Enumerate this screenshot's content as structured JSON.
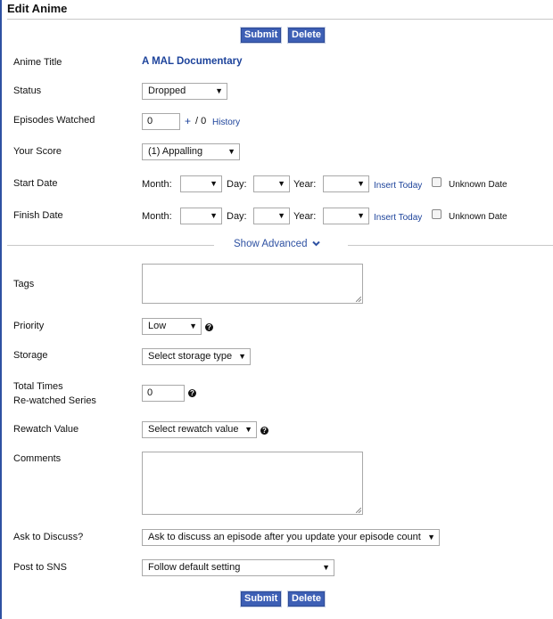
{
  "header": {
    "title": "Edit Anime"
  },
  "buttons": {
    "submit": "Submit",
    "delete": "Delete"
  },
  "form": {
    "anime_title": {
      "label": "Anime Title",
      "value": "A MAL Documentary"
    },
    "status": {
      "label": "Status",
      "value": "Dropped"
    },
    "episodes": {
      "label": "Episodes Watched",
      "value": "0",
      "plus": "+",
      "total": "/ 0",
      "history": "History"
    },
    "score": {
      "label": "Your Score",
      "value": "(1) Appalling"
    },
    "start_date": {
      "label": "Start Date",
      "month": "Month:",
      "day": "Day:",
      "year": "Year:",
      "insert_today": "Insert Today",
      "unknown": "Unknown Date"
    },
    "finish_date": {
      "label": "Finish Date",
      "month": "Month:",
      "day": "Day:",
      "year": "Year:",
      "insert_today": "Insert Today",
      "unknown": "Unknown Date"
    },
    "show_advanced": "Show Advanced",
    "tags": {
      "label": "Tags",
      "value": ""
    },
    "priority": {
      "label": "Priority",
      "value": "Low"
    },
    "storage": {
      "label": "Storage",
      "value": "Select storage type"
    },
    "rewatched": {
      "label_line1": "Total Times",
      "label_line2": "Re-watched Series",
      "value": "0"
    },
    "rewatch_value": {
      "label": "Rewatch Value",
      "value": "Select rewatch value"
    },
    "comments": {
      "label": "Comments",
      "value": ""
    },
    "ask_discuss": {
      "label": "Ask to Discuss?",
      "value": "Ask to discuss an episode after you update your episode count"
    },
    "post_sns": {
      "label": "Post to SNS",
      "value": "Follow default setting"
    }
  },
  "icons": {
    "dropdown": "caret-down-icon",
    "help": "question-circle-icon",
    "chevron": "chevron-down-icon"
  },
  "colors": {
    "accent": "#2e51a2",
    "button": "#3d5fb5",
    "link": "#1d439b"
  }
}
